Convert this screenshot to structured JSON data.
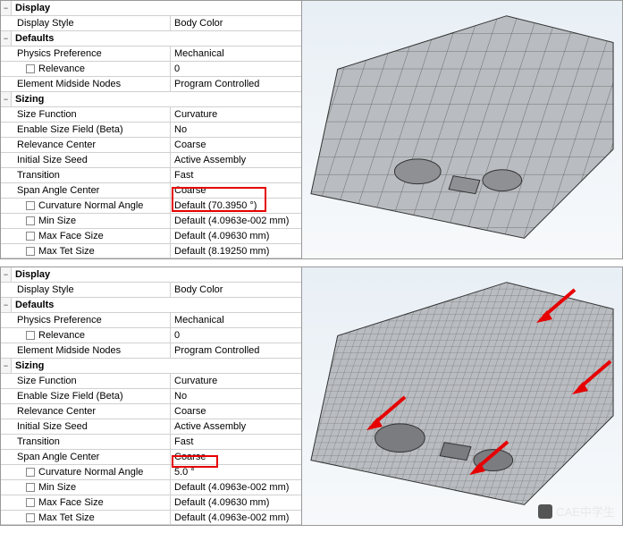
{
  "top": {
    "display_hdr": "Display",
    "display_style_label": "Display Style",
    "display_style_value": "Body Color",
    "defaults_hdr": "Defaults",
    "physics_label": "Physics Preference",
    "physics_value": "Mechanical",
    "relevance_label": "Relevance",
    "relevance_value": "0",
    "midside_label": "Element Midside Nodes",
    "midside_value": "Program Controlled",
    "sizing_hdr": "Sizing",
    "sizefn_label": "Size Function",
    "sizefn_value": "Curvature",
    "enablefield_label": "Enable Size Field (Beta)",
    "enablefield_value": "No",
    "relcenter_label": "Relevance Center",
    "relcenter_value": "Coarse",
    "initseed_label": "Initial Size Seed",
    "initseed_value": "Active Assembly",
    "transition_label": "Transition",
    "transition_value": "Fast",
    "span_label": "Span Angle Center",
    "span_value": "Coarse",
    "curvangle_label": "Curvature Normal Angle",
    "curvangle_value": "Default (70.3950 °)",
    "minsize_label": "Min Size",
    "minsize_value": "Default (4.0963e-002 mm)",
    "maxface_label": "Max Face Size",
    "maxface_value": "Default (4.09630 mm)",
    "maxtet_label": "Max Tet Size",
    "maxtet_value": "Default (8.19250 mm)"
  },
  "bottom": {
    "display_hdr": "Display",
    "display_style_label": "Display Style",
    "display_style_value": "Body Color",
    "defaults_hdr": "Defaults",
    "physics_label": "Physics Preference",
    "physics_value": "Mechanical",
    "relevance_label": "Relevance",
    "relevance_value": "0",
    "midside_label": "Element Midside Nodes",
    "midside_value": "Program Controlled",
    "sizing_hdr": "Sizing",
    "sizefn_label": "Size Function",
    "sizefn_value": "Curvature",
    "enablefield_label": "Enable Size Field (Beta)",
    "enablefield_value": "No",
    "relcenter_label": "Relevance Center",
    "relcenter_value": "Coarse",
    "initseed_label": "Initial Size Seed",
    "initseed_value": "Active Assembly",
    "transition_label": "Transition",
    "transition_value": "Fast",
    "span_label": "Span Angle Center",
    "span_value": "Coarse",
    "curvangle_label": "Curvature Normal Angle",
    "curvangle_value": "5.0 °",
    "minsize_label": "Min Size",
    "minsize_value": "Default (4.0963e-002 mm)",
    "maxface_label": "Max Face Size",
    "maxface_value": "Default (4.09630 mm)",
    "maxtet_label": "Max Tet Size",
    "maxtet_value": "Default (4.0963e-002 mm)"
  },
  "watermark": "CAE中学生"
}
